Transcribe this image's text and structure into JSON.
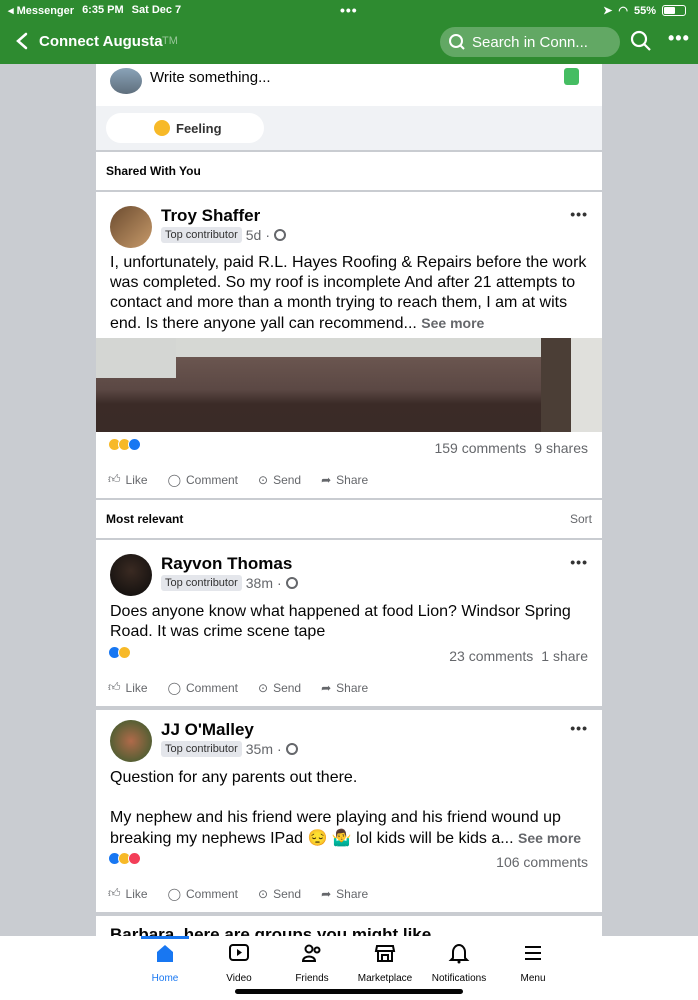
{
  "status_bar": {
    "back_app": "◂ Messenger",
    "time": "6:35 PM",
    "date": "Sat Dec 7",
    "battery": "55%",
    "battery_level": 0.55
  },
  "header": {
    "title": "Connect Augusta",
    "title_suffix": "TM",
    "search_placeholder": "Search in Conn..."
  },
  "composer": {
    "placeholder": "Write something...",
    "feeling_label": "Feeling"
  },
  "sections": {
    "shared": "Shared With You",
    "most_relevant": "Most relevant",
    "sort": "Sort"
  },
  "posts": [
    {
      "author": "Troy Shaffer",
      "badge": "Top contributor",
      "time": "5d",
      "text": "I, unfortunately, paid  R.L. Hayes Roofing & Repairs before the work was completed.   So my roof is incomplete    And after 21 attempts to contact and more than a month trying to reach them, I am at wits end.   Is there anyone yall can recommend...",
      "see_more": "See more",
      "comments": "159 comments",
      "shares": "9 shares"
    },
    {
      "author": "Rayvon Thomas",
      "badge": "Top contributor",
      "time": "38m",
      "text": "Does anyone know what happened at food Lion? Windsor Spring Road. It was crime scene tape",
      "comments": "23 comments",
      "shares": "1 share"
    },
    {
      "author": "JJ O'Malley",
      "badge": "Top contributor",
      "time": "35m",
      "text1": "Question for any parents out there.",
      "text2": "My nephew and his friend were playing and his friend wound up breaking my nephews IPad 😔 🤷‍♂️ lol kids will be kids a...",
      "see_more": "See more",
      "comments": "106 comments"
    }
  ],
  "post_actions": {
    "like": "Like",
    "comment": "Comment",
    "send": "Send",
    "share": "Share"
  },
  "groups_banner": "Barbara, here are groups you might like",
  "tabs": [
    {
      "label": "Home",
      "active": true
    },
    {
      "label": "Video"
    },
    {
      "label": "Friends"
    },
    {
      "label": "Marketplace"
    },
    {
      "label": "Notifications"
    },
    {
      "label": "Menu"
    }
  ],
  "colors": {
    "header_green": "#2e8b30",
    "accent_blue": "#1877f2"
  }
}
